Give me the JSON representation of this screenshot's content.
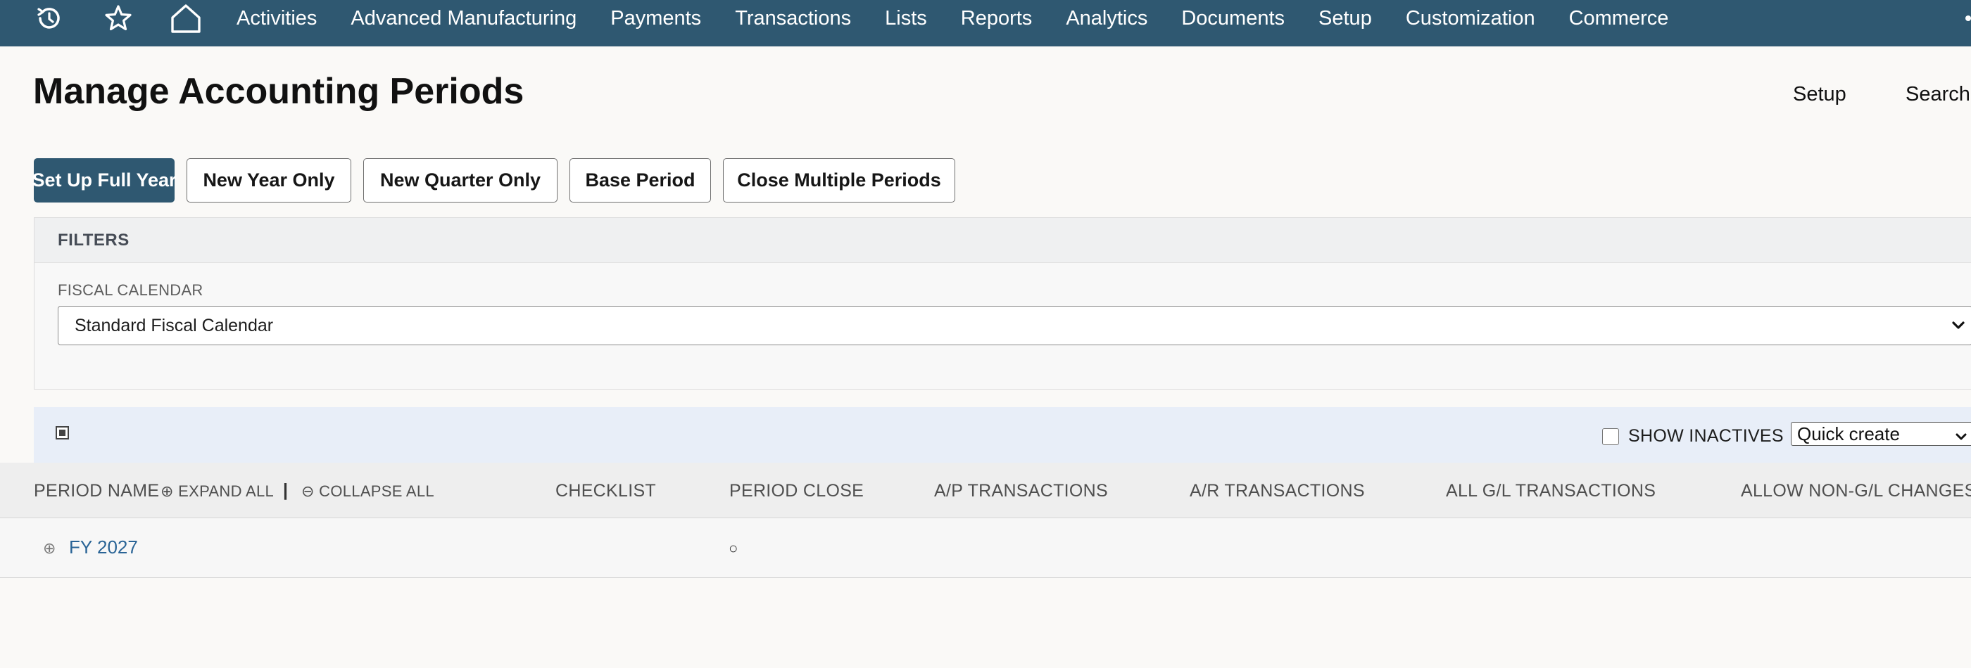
{
  "nav": {
    "items": [
      {
        "label": "Activities"
      },
      {
        "label": "Advanced Manufacturing"
      },
      {
        "label": "Payments"
      },
      {
        "label": "Transactions"
      },
      {
        "label": "Lists"
      },
      {
        "label": "Reports"
      },
      {
        "label": "Analytics"
      },
      {
        "label": "Documents"
      },
      {
        "label": "Setup"
      },
      {
        "label": "Customization"
      },
      {
        "label": "Commerce"
      }
    ],
    "icons": [
      "recent-history-icon",
      "star-icon",
      "home-icon"
    ]
  },
  "header": {
    "title": "Manage Accounting Periods",
    "links": [
      "Setup",
      "Search"
    ]
  },
  "actions": {
    "set_up_full_year": "Set Up Full Year",
    "new_year_only": "New Year Only",
    "new_quarter_only": "New Quarter Only",
    "base_period": "Base Period",
    "close_multiple_periods": "Close Multiple Periods"
  },
  "filters": {
    "heading": "FILTERS",
    "fiscal_calendar_label": "FISCAL CALENDAR",
    "fiscal_calendar_value": "Standard Fiscal Calendar"
  },
  "toolbar": {
    "show_inactives_label": "SHOW INACTIVES",
    "show_inactives_checked": false,
    "quick_create_value": "Quick create"
  },
  "table": {
    "period_name": "PERIOD NAME",
    "expand_all": "⊕ EXPAND ALL",
    "separator": "|",
    "collapse_all": "⊖ COLLAPSE ALL",
    "columns": {
      "checklist": "CHECKLIST",
      "period_close": "PERIOD CLOSE",
      "ap_transactions": "A/P TRANSACTIONS",
      "ar_transactions": "A/R TRANSACTIONS",
      "all_gl_transactions": "ALL G/L TRANSACTIONS",
      "allow_non_gl_changes": "ALLOW NON-G/L CHANGES"
    },
    "rows": [
      {
        "toggle": "⊕",
        "period_name": "FY 2027",
        "period_close": "○"
      }
    ]
  },
  "colors": {
    "nav_bg": "#2f5871",
    "primary_button": "#2f5871",
    "link": "#2a6496",
    "toolbar_bg": "#e8eef8"
  }
}
